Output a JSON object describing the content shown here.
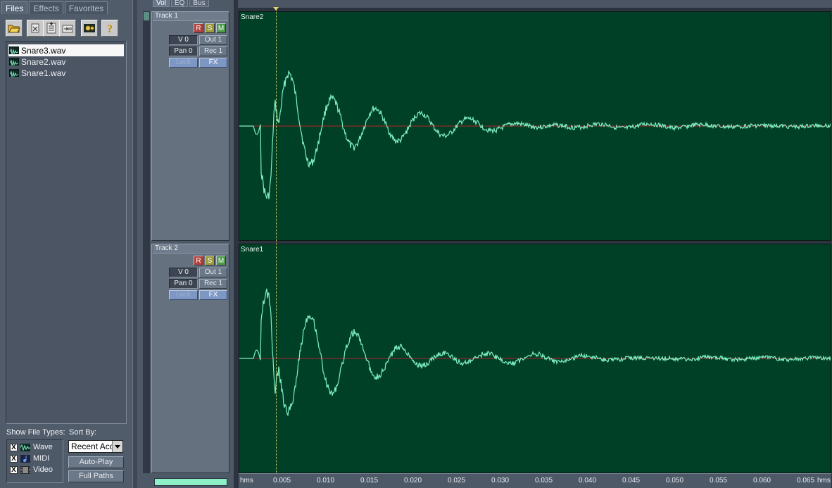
{
  "files_panel": {
    "tabs": [
      "Files",
      "Effects",
      "Favorites"
    ],
    "files": [
      "Snare3.wav",
      "Snare2.wav",
      "Snare1.wav"
    ],
    "show_file_types_label": "Show File Types:",
    "sort_by_label": "Sort By:",
    "file_types": [
      {
        "label": "Wave",
        "checked": "X",
        "icon": "wave-file-icon"
      },
      {
        "label": "MIDI",
        "checked": "X",
        "icon": "midi-file-icon"
      },
      {
        "label": "Video",
        "checked": "X",
        "icon": "video-file-icon"
      }
    ],
    "sort_value": "Recent Acc",
    "auto_play_label": "Auto-Play",
    "full_paths_label": "Full Paths",
    "toolbar_icons": [
      "open-file-icon",
      "close-file-icon",
      "close-all-icon",
      "insert-icon",
      "settings-icon",
      "help-icon"
    ]
  },
  "track_panel": {
    "column_tabs": [
      "Vol",
      "EQ",
      "Bus"
    ],
    "tracks": [
      {
        "name": "Track 1",
        "record": "R",
        "solo": "S",
        "mute": "M",
        "volume": "V 0",
        "pan": "Pan 0",
        "output": "Out 1",
        "record_input": "Rec 1",
        "lock": "Lock",
        "fx": "FX"
      },
      {
        "name": "Track 2",
        "record": "R",
        "solo": "S",
        "mute": "M",
        "volume": "V 0",
        "pan": "Pan 0",
        "output": "Out 1",
        "record_input": "Rec 1",
        "lock": "Lock",
        "fx": "FX"
      }
    ]
  },
  "waveform": {
    "clips": [
      "Snare2",
      "Snare1"
    ],
    "ruler": {
      "unit_label": "hms",
      "ticks": [
        "0.005",
        "0.010",
        "0.015",
        "0.020",
        "0.025",
        "0.030",
        "0.035",
        "0.040",
        "0.045",
        "0.050",
        "0.055",
        "0.060",
        "0.065"
      ]
    },
    "colors": {
      "background": "#004027",
      "wave": "#7ff0c4",
      "center_line": "#b8242a",
      "cursor": "#d9d66a"
    }
  }
}
